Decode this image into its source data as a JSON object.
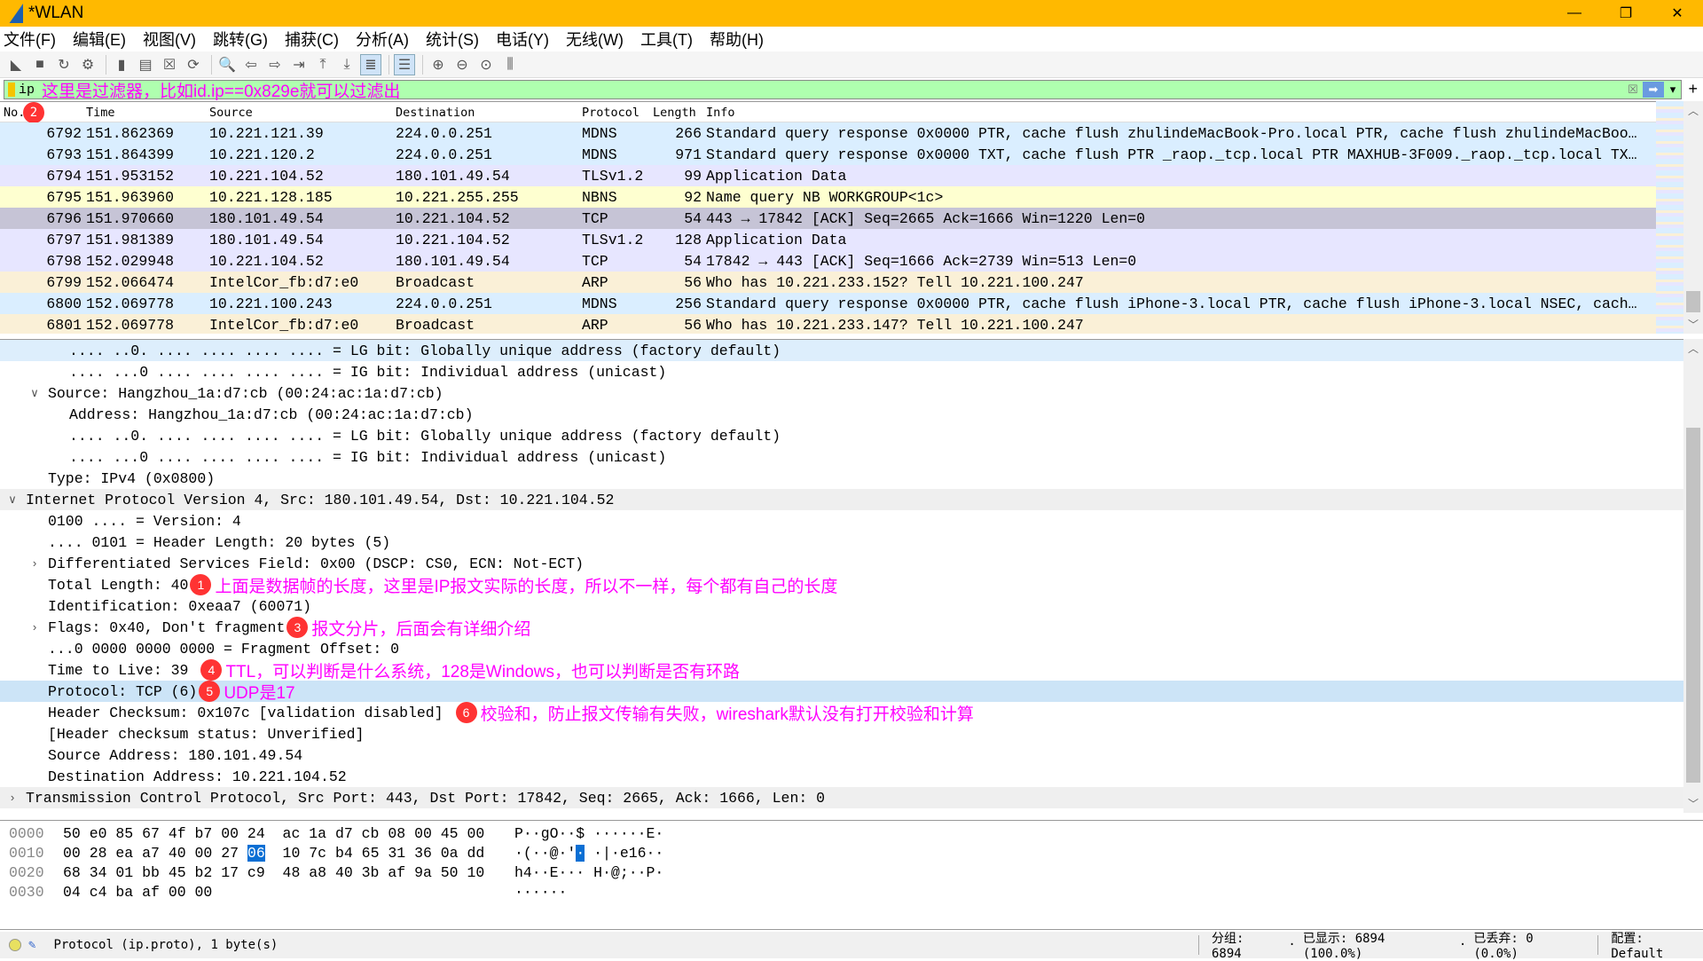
{
  "window": {
    "title": "*WLAN",
    "controls": [
      "—",
      "❐",
      "✕"
    ]
  },
  "menu": [
    "文件(F)",
    "编辑(E)",
    "视图(V)",
    "跳转(G)",
    "捕获(C)",
    "分析(A)",
    "统计(S)",
    "电话(Y)",
    "无线(W)",
    "工具(T)",
    "帮助(H)"
  ],
  "toolbar": [
    {
      "icon": "shark-fin-start-icon",
      "glyph": "◣"
    },
    {
      "icon": "stop-icon",
      "glyph": "■"
    },
    {
      "icon": "restart-icon",
      "glyph": "↻"
    },
    {
      "icon": "capture-options-icon",
      "glyph": "⚙"
    },
    "sep",
    {
      "icon": "open-file-icon",
      "glyph": "▮"
    },
    {
      "icon": "save-file-icon",
      "glyph": "▤"
    },
    {
      "icon": "close-file-icon",
      "glyph": "☒"
    },
    {
      "icon": "reload-icon",
      "glyph": "⟳"
    },
    "sep",
    {
      "icon": "find-icon",
      "glyph": "🔍"
    },
    {
      "icon": "back-icon",
      "glyph": "⇦"
    },
    {
      "icon": "forward-icon",
      "glyph": "⇨"
    },
    {
      "icon": "go-to-packet-icon",
      "glyph": "⇥"
    },
    {
      "icon": "first-packet-icon",
      "glyph": "⤒"
    },
    {
      "icon": "last-packet-icon",
      "glyph": "⤓"
    },
    {
      "icon": "autoscroll-icon",
      "glyph": "≣",
      "on": true
    },
    "sep",
    {
      "icon": "colorize-icon",
      "glyph": "☰",
      "on": true
    },
    "sep",
    {
      "icon": "zoom-in-icon",
      "glyph": "⊕"
    },
    {
      "icon": "zoom-out-icon",
      "glyph": "⊖"
    },
    {
      "icon": "zoom-reset-icon",
      "glyph": "⊙"
    },
    {
      "icon": "resize-columns-icon",
      "glyph": "⫼"
    }
  ],
  "filter": {
    "value": "ip",
    "annotation": "这里是过滤器，比如id.ip==0x829e就可以过滤出",
    "clear_icon": "☒",
    "apply_icon": "➡",
    "dropdown_icon": "▾",
    "add_icon": "+"
  },
  "packet_list": {
    "columns": [
      "No.",
      "Time",
      "Source",
      "Destination",
      "Protocol",
      "Length",
      "Info"
    ],
    "header_badge": "2",
    "colors": {
      "MDNS": "#daeeff",
      "TLS": "#e7e6ff",
      "NBNS": "#feffd0",
      "SELECTED": "#c6c4d6",
      "ARP": "#faf0d7"
    },
    "rows": [
      {
        "no": "6792",
        "time": "151.862369",
        "src": "10.221.121.39",
        "dst": "224.0.0.251",
        "proto": "MDNS",
        "len": "266",
        "info": "Standard query response 0x0000 PTR, cache flush zhulindeMacBook-Pro.local PTR, cache flush zhulindeMacBoo…",
        "color": "MDNS"
      },
      {
        "no": "6793",
        "time": "151.864399",
        "src": "10.221.120.2",
        "dst": "224.0.0.251",
        "proto": "MDNS",
        "len": "971",
        "info": "Standard query response 0x0000 TXT, cache flush PTR _raop._tcp.local PTR MAXHUB-3F009._raop._tcp.local TX…",
        "color": "MDNS"
      },
      {
        "no": "6794",
        "time": "151.953152",
        "src": "10.221.104.52",
        "dst": "180.101.49.54",
        "proto": "TLSv1.2",
        "len": "99",
        "info": "Application Data",
        "color": "TLS"
      },
      {
        "no": "6795",
        "time": "151.963960",
        "src": "10.221.128.185",
        "dst": "10.221.255.255",
        "proto": "NBNS",
        "len": "92",
        "info": "Name query NB WORKGROUP<1c>",
        "color": "NBNS"
      },
      {
        "no": "6796",
        "time": "151.970660",
        "src": "180.101.49.54",
        "dst": "10.221.104.52",
        "proto": "TCP",
        "len": "54",
        "info": "443 → 17842 [ACK] Seq=2665 Ack=1666 Win=1220 Len=0",
        "color": "SELECTED",
        "selected": true
      },
      {
        "no": "6797",
        "time": "151.981389",
        "src": "180.101.49.54",
        "dst": "10.221.104.52",
        "proto": "TLSv1.2",
        "len": "128",
        "info": "Application Data",
        "color": "TLS"
      },
      {
        "no": "6798",
        "time": "152.029948",
        "src": "10.221.104.52",
        "dst": "180.101.49.54",
        "proto": "TCP",
        "len": "54",
        "info": "17842 → 443 [ACK] Seq=1666 Ack=2739 Win=513 Len=0",
        "color": "TLS"
      },
      {
        "no": "6799",
        "time": "152.066474",
        "src": "IntelCor_fb:d7:e0",
        "dst": "Broadcast",
        "proto": "ARP",
        "len": "56",
        "info": "Who has 10.221.233.152? Tell 10.221.100.247",
        "color": "ARP"
      },
      {
        "no": "6800",
        "time": "152.069778",
        "src": "10.221.100.243",
        "dst": "224.0.0.251",
        "proto": "MDNS",
        "len": "256",
        "info": "Standard query response 0x0000 PTR, cache flush iPhone-3.local PTR, cache flush iPhone-3.local NSEC, cach…",
        "color": "MDNS"
      },
      {
        "no": "6801",
        "time": "152.069778",
        "src": "IntelCor_fb:d7:e0",
        "dst": "Broadcast",
        "proto": "ARP",
        "len": "56",
        "info": "Who has 10.221.233.147? Tell 10.221.100.247",
        "color": "ARP"
      }
    ]
  },
  "details": [
    {
      "lvl": 2,
      "text": ".... ..0. .... .... .... .... = LG bit: Globally unique address (factory default)",
      "cls": "hl"
    },
    {
      "lvl": 2,
      "text": ".... ...0 .... .... .... .... = IG bit: Individual address (unicast)"
    },
    {
      "lvl": 1,
      "text": "Source: Hangzhou_1a:d7:cb (00:24:ac:1a:d7:cb)",
      "exp": "open"
    },
    {
      "lvl": 2,
      "text": "Address: Hangzhou_1a:d7:cb (00:24:ac:1a:d7:cb)"
    },
    {
      "lvl": 2,
      "text": ".... ..0. .... .... .... .... = LG bit: Globally unique address (factory default)"
    },
    {
      "lvl": 2,
      "text": ".... ...0 .... .... .... .... = IG bit: Individual address (unicast)"
    },
    {
      "lvl": 1,
      "text": "Type: IPv4 (0x0800)"
    },
    {
      "lvl": 0,
      "text": "Internet Protocol Version 4, Src: 180.101.49.54, Dst: 10.221.104.52",
      "exp": "open",
      "cls": "hdr"
    },
    {
      "lvl": 1,
      "text": "0100 .... = Version: 4"
    },
    {
      "lvl": 1,
      "text": ".... 0101 = Header Length: 20 bytes (5)"
    },
    {
      "lvl": 1,
      "text": "Differentiated Services Field: 0x00 (DSCP: CS0, ECN: Not-ECT)",
      "exp": "closed"
    },
    {
      "lvl": 1,
      "text": "Total Length: 40",
      "note": {
        "n": "1",
        "text": "上面是数据帧的长度，这里是IP报文实际的长度，所以不一样，每个都有自己的长度"
      }
    },
    {
      "lvl": 1,
      "text": "Identification: 0xeaa7 (60071)"
    },
    {
      "lvl": 1,
      "text": "Flags: 0x40, Don't fragment",
      "exp": "closed",
      "note": {
        "n": "3",
        "text": "报文分片，后面会有详细介绍"
      }
    },
    {
      "lvl": 1,
      "text": "...0 0000 0000 0000 = Fragment Offset: 0"
    },
    {
      "lvl": 1,
      "text": "Time to Live: 39",
      "note": {
        "n": "4",
        "text": "TTL，可以判断是什么系统，128是Windows，也可以判断是否有环路",
        "gap": true
      }
    },
    {
      "lvl": 1,
      "text": "Protocol: TCP (6)",
      "cls": "sel",
      "note": {
        "n": "5",
        "text": "UDP是17"
      }
    },
    {
      "lvl": 1,
      "text": "Header Checksum: 0x107c [validation disabled]",
      "note": {
        "n": "6",
        "text": "校验和，防止报文传输有失败，wireshark默认没有打开校验和计算",
        "gap": true
      }
    },
    {
      "lvl": 1,
      "text": "[Header checksum status: Unverified]"
    },
    {
      "lvl": 1,
      "text": "Source Address: 180.101.49.54"
    },
    {
      "lvl": 1,
      "text": "Destination Address: 10.221.104.52"
    },
    {
      "lvl": 0,
      "text": "Transmission Control Protocol, Src Port: 443, Dst Port: 17842, Seq: 2665, Ack: 1666, Len: 0",
      "exp": "closed",
      "cls": "hdr"
    }
  ],
  "hex": [
    {
      "off": "0000",
      "pre": "50 e0 85 67 4f b7 00 24  ac 1a d7 cb 08 00 45 00",
      "sel": "",
      "post": "",
      "ascii_pre": "P··gO··$ ······E·",
      "ascii_sel": "",
      "ascii_post": ""
    },
    {
      "off": "0010",
      "pre": "00 28 ea a7 40 00 27 ",
      "sel": "06",
      "post": "  10 7c b4 65 31 36 0a dd",
      "ascii_pre": "·(··@·'",
      "ascii_sel": "·",
      "ascii_post": " ·|·e16··"
    },
    {
      "off": "0020",
      "pre": "68 34 01 bb 45 b2 17 c9  48 a8 40 3b af 9a 50 10",
      "sel": "",
      "post": "",
      "ascii_pre": "h4··E··· H·@;··P·",
      "ascii_sel": "",
      "ascii_post": ""
    },
    {
      "off": "0030",
      "pre": "04 c4 ba af 00 00",
      "sel": "",
      "post": "",
      "ascii_pre": "······",
      "ascii_sel": "",
      "ascii_post": ""
    }
  ],
  "status": {
    "field": "Protocol (ip.proto), 1 byte(s)",
    "packets": "分组: 6894",
    "displayed": "已显示: 6894 (100.0%)",
    "dropped": "已丢弃: 0 (0.0%)",
    "profile": "配置: Default",
    "sep": "·"
  }
}
